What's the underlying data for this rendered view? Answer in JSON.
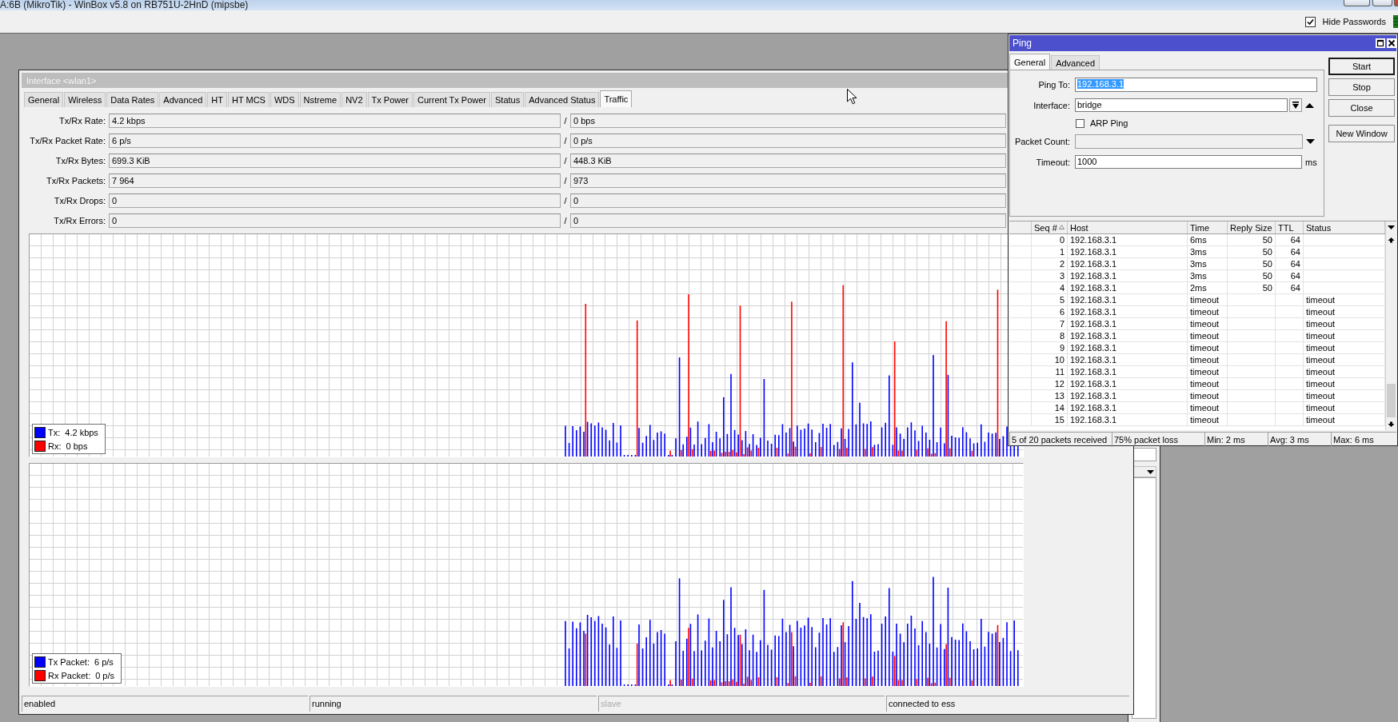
{
  "app_window": {
    "title": "A:6B (MikroTik) - WinBox v5.8 on RB751U-2HnD (mipsbe)",
    "hide_passwords": {
      "label": "Hide Passwords",
      "checked": true
    }
  },
  "interface_window": {
    "title": "Interface <wlan1>",
    "active": false,
    "tabs": [
      {
        "label": "General",
        "selected": false
      },
      {
        "label": "Wireless",
        "selected": false
      },
      {
        "label": "Data Rates",
        "selected": false
      },
      {
        "label": "Advanced",
        "selected": false
      },
      {
        "label": "HT",
        "selected": false
      },
      {
        "label": "HT MCS",
        "selected": false
      },
      {
        "label": "WDS",
        "selected": false
      },
      {
        "label": "Nstreme",
        "selected": false
      },
      {
        "label": "NV2",
        "selected": false
      },
      {
        "label": "Tx Power",
        "selected": false
      },
      {
        "label": "Current Tx Power",
        "selected": false
      },
      {
        "label": "Status",
        "selected": false
      },
      {
        "label": "Advanced Status",
        "selected": false
      },
      {
        "label": "Traffic",
        "selected": true
      }
    ],
    "fields": [
      {
        "label": "Tx/Rx Rate:",
        "tx": "4.2 kbps",
        "separator": "/",
        "rx": "0 bps"
      },
      {
        "label": "Tx/Rx Packet Rate:",
        "tx": "6 p/s",
        "separator": "/",
        "rx": "0 p/s"
      },
      {
        "label": "Tx/Rx Bytes:",
        "tx": "699.3 KiB",
        "separator": "/",
        "rx": "448.3 KiB"
      },
      {
        "label": "Tx/Rx Packets:",
        "tx": "7 964",
        "separator": "/",
        "rx": "973"
      },
      {
        "label": "Tx/Rx Drops:",
        "tx": "0",
        "separator": "/",
        "rx": "0"
      },
      {
        "label": "Tx/Rx Errors:",
        "tx": "0",
        "separator": "/",
        "rx": "0"
      }
    ],
    "graphs": [
      {
        "legend": [
          {
            "label": "Tx:",
            "value": "4.2 kbps",
            "color": "#0000ff"
          },
          {
            "label": "Rx:",
            "value": "0 bps",
            "color": "#ff0000"
          }
        ]
      },
      {
        "legend": [
          {
            "label": "Tx Packet:",
            "value": "6 p/s",
            "color": "#0000ff"
          },
          {
            "label": "Rx Packet:",
            "value": "0 p/s",
            "color": "#ff0000"
          }
        ]
      }
    ],
    "status_bar": [
      {
        "text": "enabled",
        "disabled": false
      },
      {
        "text": "running",
        "disabled": false
      },
      {
        "text": "slave",
        "disabled": true
      },
      {
        "text": "connected to ess",
        "disabled": false
      }
    ]
  },
  "ping_window": {
    "title": "Ping",
    "active": true,
    "tabs": [
      {
        "label": "General",
        "selected": true
      },
      {
        "label": "Advanced",
        "selected": false
      }
    ],
    "form": {
      "ping_to": {
        "label": "Ping To:",
        "value": "192.168.3.1",
        "selected": true
      },
      "interface": {
        "label": "Interface:",
        "value": "bridge"
      },
      "arp_ping": {
        "label": "ARP Ping",
        "checked": false
      },
      "packet_count": {
        "label": "Packet Count:"
      },
      "timeout": {
        "label": "Timeout:",
        "value": "1000",
        "unit": "ms"
      }
    },
    "buttons": [
      {
        "label": "Start",
        "default": true
      },
      {
        "label": "Stop",
        "default": false
      },
      {
        "label": "Close",
        "default": false
      },
      {
        "label": "New Window",
        "default": false
      }
    ],
    "table": {
      "columns": [
        {
          "label": "Seq #",
          "sorted": true
        },
        {
          "label": "Host",
          "sorted": false
        },
        {
          "label": "Time",
          "sorted": false
        },
        {
          "label": "Reply Size",
          "sorted": false
        },
        {
          "label": "TTL",
          "sorted": false
        },
        {
          "label": "Status",
          "sorted": false
        }
      ],
      "rows": [
        {
          "seq": "0",
          "host": "192.168.3.1",
          "time": "6ms",
          "reply_size": "50",
          "ttl": "64"
        },
        {
          "seq": "1",
          "host": "192.168.3.1",
          "time": "3ms",
          "reply_size": "50",
          "ttl": "64"
        },
        {
          "seq": "2",
          "host": "192.168.3.1",
          "time": "3ms",
          "reply_size": "50",
          "ttl": "64"
        },
        {
          "seq": "3",
          "host": "192.168.3.1",
          "time": "3ms",
          "reply_size": "50",
          "ttl": "64"
        },
        {
          "seq": "4",
          "host": "192.168.3.1",
          "time": "2ms",
          "reply_size": "50",
          "ttl": "64"
        },
        {
          "seq": "5",
          "host": "192.168.3.1",
          "time": "timeout",
          "status": "timeout"
        },
        {
          "seq": "6",
          "host": "192.168.3.1",
          "time": "timeout",
          "status": "timeout"
        },
        {
          "seq": "7",
          "host": "192.168.3.1",
          "time": "timeout",
          "status": "timeout"
        },
        {
          "seq": "8",
          "host": "192.168.3.1",
          "time": "timeout",
          "status": "timeout"
        },
        {
          "seq": "9",
          "host": "192.168.3.1",
          "time": "timeout",
          "status": "timeout"
        },
        {
          "seq": "10",
          "host": "192.168.3.1",
          "time": "timeout",
          "status": "timeout"
        },
        {
          "seq": "11",
          "host": "192.168.3.1",
          "time": "timeout",
          "status": "timeout"
        },
        {
          "seq": "12",
          "host": "192.168.3.1",
          "time": "timeout",
          "status": "timeout"
        },
        {
          "seq": "13",
          "host": "192.168.3.1",
          "time": "timeout",
          "status": "timeout"
        },
        {
          "seq": "14",
          "host": "192.168.3.1",
          "time": "timeout",
          "status": "timeout"
        },
        {
          "seq": "15",
          "host": "192.168.3.1",
          "time": "timeout",
          "status": "timeout"
        }
      ]
    },
    "status_bar": [
      "5 of 20 packets received",
      "75% packet loss",
      "Min: 2 ms",
      "Avg: 3 ms",
      "Max: 6 ms"
    ]
  }
}
